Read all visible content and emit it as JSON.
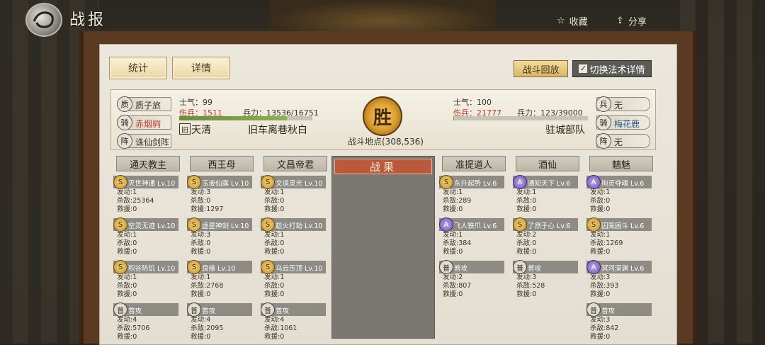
{
  "header": {
    "title": "战报",
    "favorite_label": "收藏",
    "share_label": "分享"
  },
  "tabs": {
    "stats": "统计",
    "details": "详情"
  },
  "actions": {
    "replay": "战斗回放",
    "switch": "切换法术详情"
  },
  "summary": {
    "left": {
      "pills": [
        {
          "icon": "质",
          "label": "质子旅"
        },
        {
          "icon": "骑",
          "label": "赤烟驹"
        },
        {
          "icon": "阵",
          "label": "诛仙剑阵"
        }
      ],
      "morale": "士气：99",
      "wounded_label": "伤兵：",
      "wounded": "1511",
      "troops": "兵力：13536/16751",
      "troop_fraction": 0.81,
      "faction_icon": "旧",
      "name1": "天清",
      "name2": "旧车离巷秋白"
    },
    "right": {
      "pills": [
        {
          "icon": "兵",
          "label": "无"
        },
        {
          "icon": "骑",
          "label": "梅花鹿"
        },
        {
          "icon": "阵",
          "label": "无"
        }
      ],
      "morale": "士气：100",
      "wounded_label": "伤兵：",
      "wounded": "21777",
      "troops": "兵力：123/39000",
      "troop_fraction": 0.003,
      "name": "驻城部队"
    },
    "result_badge": "胜",
    "location": "战斗地点(308,536)"
  },
  "result_header": "战果",
  "columns": [
    {
      "name": "通天教主",
      "skills": [
        {
          "type": "S",
          "name": "灭世神通 Lv.10",
          "stats": [
            "发动:1",
            "杀敌:25364",
            "救援:0"
          ]
        },
        {
          "type": "S",
          "name": "空灵无迹 Lv.10",
          "stats": [
            "发动:1",
            "杀敌:0",
            "救援:0"
          ]
        },
        {
          "type": "S",
          "name": "积谷防饥 Lv.10",
          "stats": [
            "发动:1",
            "杀敌:0",
            "救援:0"
          ]
        },
        {
          "type": "普",
          "name": "普攻",
          "stats": [
            "发动:4",
            "杀敌:5706",
            "救援:0"
          ]
        }
      ]
    },
    {
      "name": "西王母",
      "skills": [
        {
          "type": "S",
          "name": "玉液仙露 Lv.10",
          "stats": [
            "发动:3",
            "杀敌:0",
            "救援:1297"
          ]
        },
        {
          "type": "S",
          "name": "虚星神剑 Lv.10",
          "stats": [
            "发动:3",
            "杀敌:0",
            "救援:0"
          ]
        },
        {
          "type": "S",
          "name": "良缘 Lv.10",
          "stats": [
            "发动:1",
            "杀敌:2768",
            "救援:0"
          ]
        },
        {
          "type": "普",
          "name": "普攻",
          "stats": [
            "发动:4",
            "杀敌:2095",
            "救援:0"
          ]
        }
      ]
    },
    {
      "name": "文昌帝君",
      "skills": [
        {
          "type": "S",
          "name": "文道灵光 Lv.10",
          "stats": [
            "发动:1",
            "杀敌:0",
            "救援:0"
          ]
        },
        {
          "type": "S",
          "name": "趁火打劫 Lv.10",
          "stats": [
            "发动:1",
            "杀敌:0",
            "救援:0"
          ]
        },
        {
          "type": "S",
          "name": "乌云压顶 Lv.10",
          "stats": [
            "发动:1",
            "杀敌:0",
            "救援:0"
          ]
        },
        {
          "type": "普",
          "name": "普攻",
          "stats": [
            "发动:4",
            "杀敌:1061",
            "救援:0"
          ]
        }
      ]
    },
    {
      "name": "准提道人",
      "skills": [
        {
          "type": "S",
          "name": "东升起势 Lv.6",
          "stats": [
            "发动:1",
            "杀敌:289",
            "救援:0"
          ]
        },
        {
          "type": "A",
          "name": "飞人铁爪 Lv.6",
          "stats": [
            "发动:1",
            "杀敌:384",
            "救援:0"
          ]
        },
        {
          "type": "普",
          "name": "普攻",
          "stats": [
            "发动:2",
            "杀敌:807",
            "救援:0"
          ]
        }
      ]
    },
    {
      "name": "酒仙",
      "skills": [
        {
          "type": "A",
          "name": "通知天下 Lv.6",
          "stats": [
            "发动:1",
            "杀敌:0",
            "救援:0"
          ]
        },
        {
          "type": "S",
          "name": "了然于心 Lv.6",
          "stats": [
            "发动:2",
            "杀敌:0",
            "救援:0"
          ]
        },
        {
          "type": "普",
          "name": "普攻",
          "stats": [
            "发动:3",
            "杀敌:528",
            "救援:0"
          ]
        }
      ]
    },
    {
      "name": "魑魅",
      "skills": [
        {
          "type": "A",
          "name": "拘灵夺魂 Lv.6",
          "stats": [
            "发动:1",
            "杀敌:0",
            "救援:0"
          ]
        },
        {
          "type": "S",
          "name": "囚笼困斗 Lv.6",
          "stats": [
            "发动:1",
            "杀敌:1269",
            "救援:0"
          ]
        },
        {
          "type": "A",
          "name": "冥河深渊 Lv.6",
          "stats": [
            "发动:3",
            "杀敌:393",
            "救援:0"
          ]
        },
        {
          "type": "普",
          "name": "普攻",
          "stats": [
            "发动:3",
            "杀敌:842",
            "救援:0"
          ]
        }
      ]
    }
  ]
}
